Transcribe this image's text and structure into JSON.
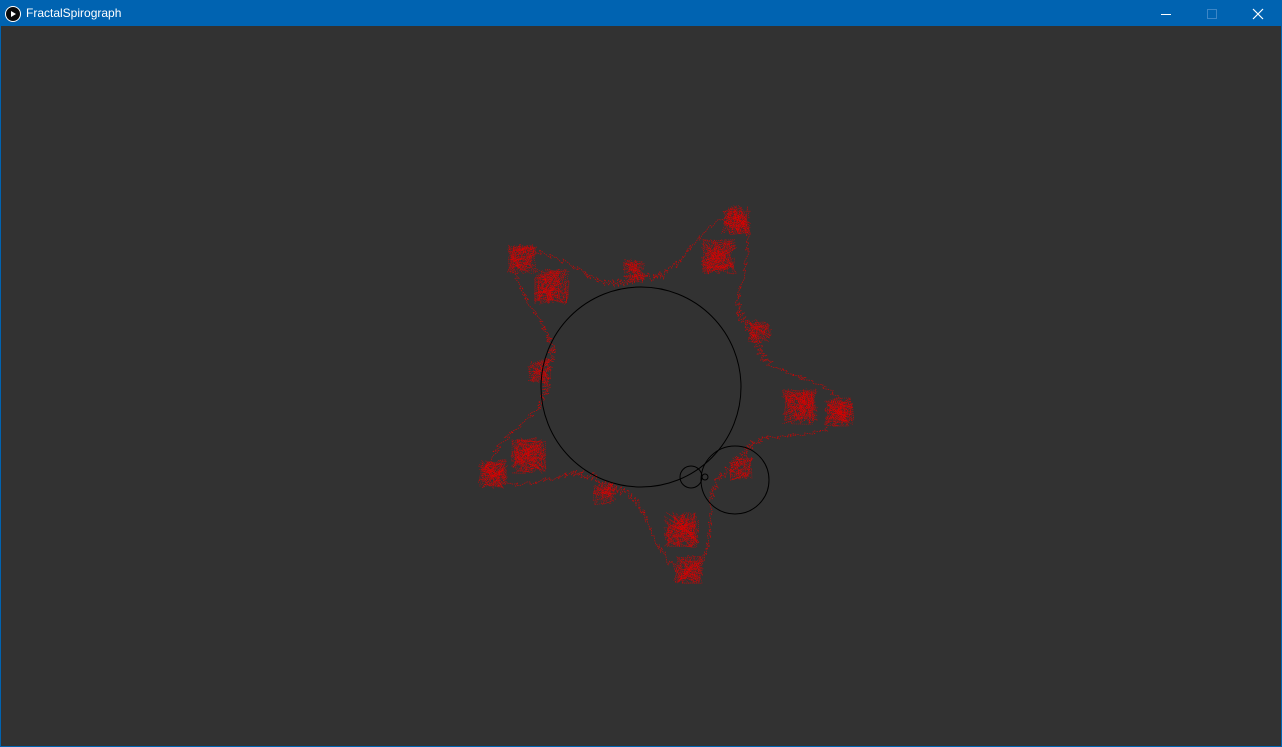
{
  "window": {
    "title": "FractalSpirograph",
    "controls": {
      "minimize_icon": "minimize-icon",
      "maximize_icon": "maximize-icon",
      "close_icon": "close-icon"
    }
  },
  "colors": {
    "titlebar": "#0063b1",
    "canvas_background": "#323232",
    "trace": "#e00000",
    "circles": "#000000"
  },
  "drawing": {
    "type": "fractal-spirograph",
    "circles": 3,
    "trace_color_name": "red"
  }
}
